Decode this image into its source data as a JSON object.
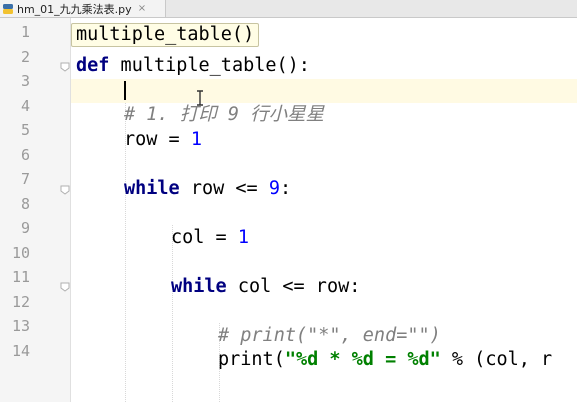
{
  "tab": {
    "filename": "hm_01_九九乘法表.py",
    "close_glyph": "×",
    "icon": "python-file-icon"
  },
  "breadcrumb": {
    "label": "multiple_table()"
  },
  "gutter": {
    "line_numbers": [
      "1",
      "2",
      "3",
      "4",
      "5",
      "6",
      "7",
      "8",
      "9",
      "10",
      "11",
      "12",
      "13",
      "14"
    ]
  },
  "code": {
    "l1_kw": "def",
    "l1_rest": " multiple_table():",
    "l3_comment": "# 1. 打印 9 行小星星",
    "l4_a": "row = ",
    "l4_num": "1",
    "l6_kw": "while",
    "l6_a": " row <= ",
    "l6_num": "9",
    "l6_b": ":",
    "l8_a": "col = ",
    "l8_num": "1",
    "l10_kw": "while",
    "l10_a": " col <= row:",
    "l12_comment": "# print(\"*\", end=\"\")",
    "l13_a": "print(",
    "l13_str": "\"%d * %d = %d\"",
    "l13_b": " % (col, r"
  },
  "colors": {
    "keyword": "#000080",
    "number": "#0000ff",
    "string": "#008000",
    "comment": "#808080",
    "caret_line": "#fffae3"
  }
}
